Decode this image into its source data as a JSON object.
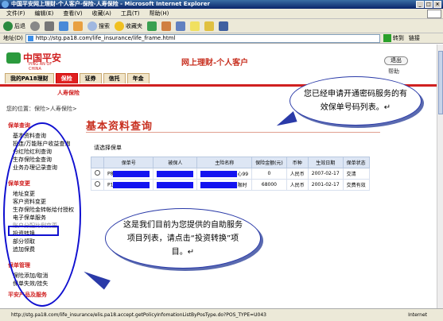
{
  "window": {
    "title": "中国平安网上理财-个人客户-保险-人寿保险 - Microsoft Internet Explorer"
  },
  "menu": [
    "文件(F)",
    "编辑(E)",
    "查看(V)",
    "收藏(A)",
    "工具(T)",
    "帮助(H)"
  ],
  "toolbar": {
    "back": "后退",
    "search": "搜索",
    "favorites": "收藏夹"
  },
  "address": {
    "label": "地址(D)",
    "url": "http://stg.pa18.com/life_insurance/life_frame.html",
    "go": "转到",
    "links": "链接"
  },
  "header": {
    "logo_cn": "中国平安",
    "logo_en": "PING AN OF CHINA",
    "site_title": "网上理财-个人客户",
    "exit": "退出",
    "help": "帮助"
  },
  "nav": {
    "tabs": [
      "我的PA18理财",
      "保险",
      "证券",
      "信托",
      "年金"
    ],
    "active_index": 1,
    "sub": "人寿保险"
  },
  "breadcrumb": "您的位置：保险>人寿保险>",
  "sidebar": {
    "sections": [
      {
        "title": "保单查询",
        "items": [
          "基本资料查询",
          "投连/万能账户收益查询",
          "分红险红利查询",
          "生存保险金查询",
          "业务办理记录查询"
        ]
      },
      {
        "title": "保单变更",
        "items": [
          "地址变更",
          "客户资料变更",
          "生存保险金转帐给付授权",
          "电子保单服务",
          "账户分配比例变更",
          "投资转换",
          "部分领取",
          "追加保费"
        ]
      },
      {
        "title": "保单管理",
        "items": [
          "保险添加/取消",
          "保单失效/挂失"
        ]
      },
      {
        "title": "平安产品及服务",
        "items": []
      }
    ]
  },
  "main": {
    "title": "基本资料查询",
    "select_label": "请选择保单",
    "columns": [
      "保单号",
      "被保人",
      "主险名称",
      "保险金额(元)",
      "币种",
      "生效日期",
      "保单状态"
    ],
    "rows": [
      {
        "prefix": "P8",
        "product_suffix": "心99",
        "amount": "0",
        "currency": "人民币",
        "date": "2007-02-17",
        "status": "交清"
      },
      {
        "prefix": "P1",
        "product_suffix": "限时",
        "amount": "68000",
        "currency": "人民币",
        "date": "2001-02-17",
        "status": "交费有效"
      }
    ]
  },
  "callouts": {
    "top": "您已经申请开通密码服务的有效保单号码列表。↵",
    "bottom": "这是我们目前为您提供的自助服务项目列表，请点击“投资转换”项目。↵"
  },
  "status": {
    "url": "http://stg.pa18.com/life_insurance/elis.pa18.accept.getPolicyInfomationListByPosType.do?POS_TYPE=U043",
    "zone": "Internet"
  },
  "colors": {
    "brand_red": "#d02020",
    "callout_border": "#2a3aa8",
    "redaction": "#1414f0"
  }
}
